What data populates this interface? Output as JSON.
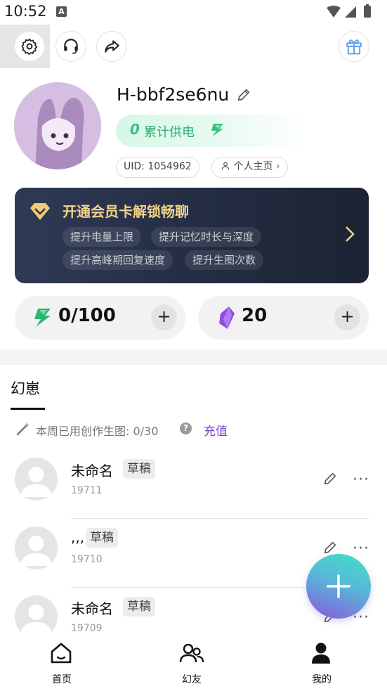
{
  "status_bar": {
    "time": "10:52"
  },
  "toolbar": {
    "settings": "settings-icon",
    "support": "headset-icon",
    "share": "share-icon",
    "gift": "gift-icon"
  },
  "profile": {
    "username": "H-bbf2se6nu",
    "power": {
      "count": "0",
      "label": "累计供电"
    },
    "uid_label": "UID: 1054962",
    "homepage_label": "个人主页"
  },
  "vip_card": {
    "title": "开通会员卡解锁畅聊",
    "perks": [
      "提升电量上限",
      "提升记忆时长与深度",
      "提升高峰期回复速度",
      "提升生图次数"
    ]
  },
  "counters": {
    "energy": "0/100",
    "crystal": "20",
    "plus": "+"
  },
  "tabs": {
    "active": "幻崽"
  },
  "quota": {
    "text": "本周已用创作生图: 0/30",
    "help": "?",
    "recharge": "充值"
  },
  "characters": [
    {
      "name": "未命名",
      "badge": "草稿",
      "id": "19711"
    },
    {
      "name": ",,,",
      "badge": "草稿",
      "id": "19710"
    },
    {
      "name": "未命名",
      "badge": "草稿",
      "id": "19709"
    }
  ],
  "bottom_nav": [
    {
      "label": "首页",
      "icon": "home-icon"
    },
    {
      "label": "幻友",
      "icon": "friends-icon"
    },
    {
      "label": "我的",
      "icon": "profile-icon",
      "active": true
    }
  ],
  "colors": {
    "vip_gold": "#f1d28a",
    "power_green": "#2fae72",
    "recharge_purple": "#7a3fcf",
    "vip_bg": "#2f3a55"
  }
}
